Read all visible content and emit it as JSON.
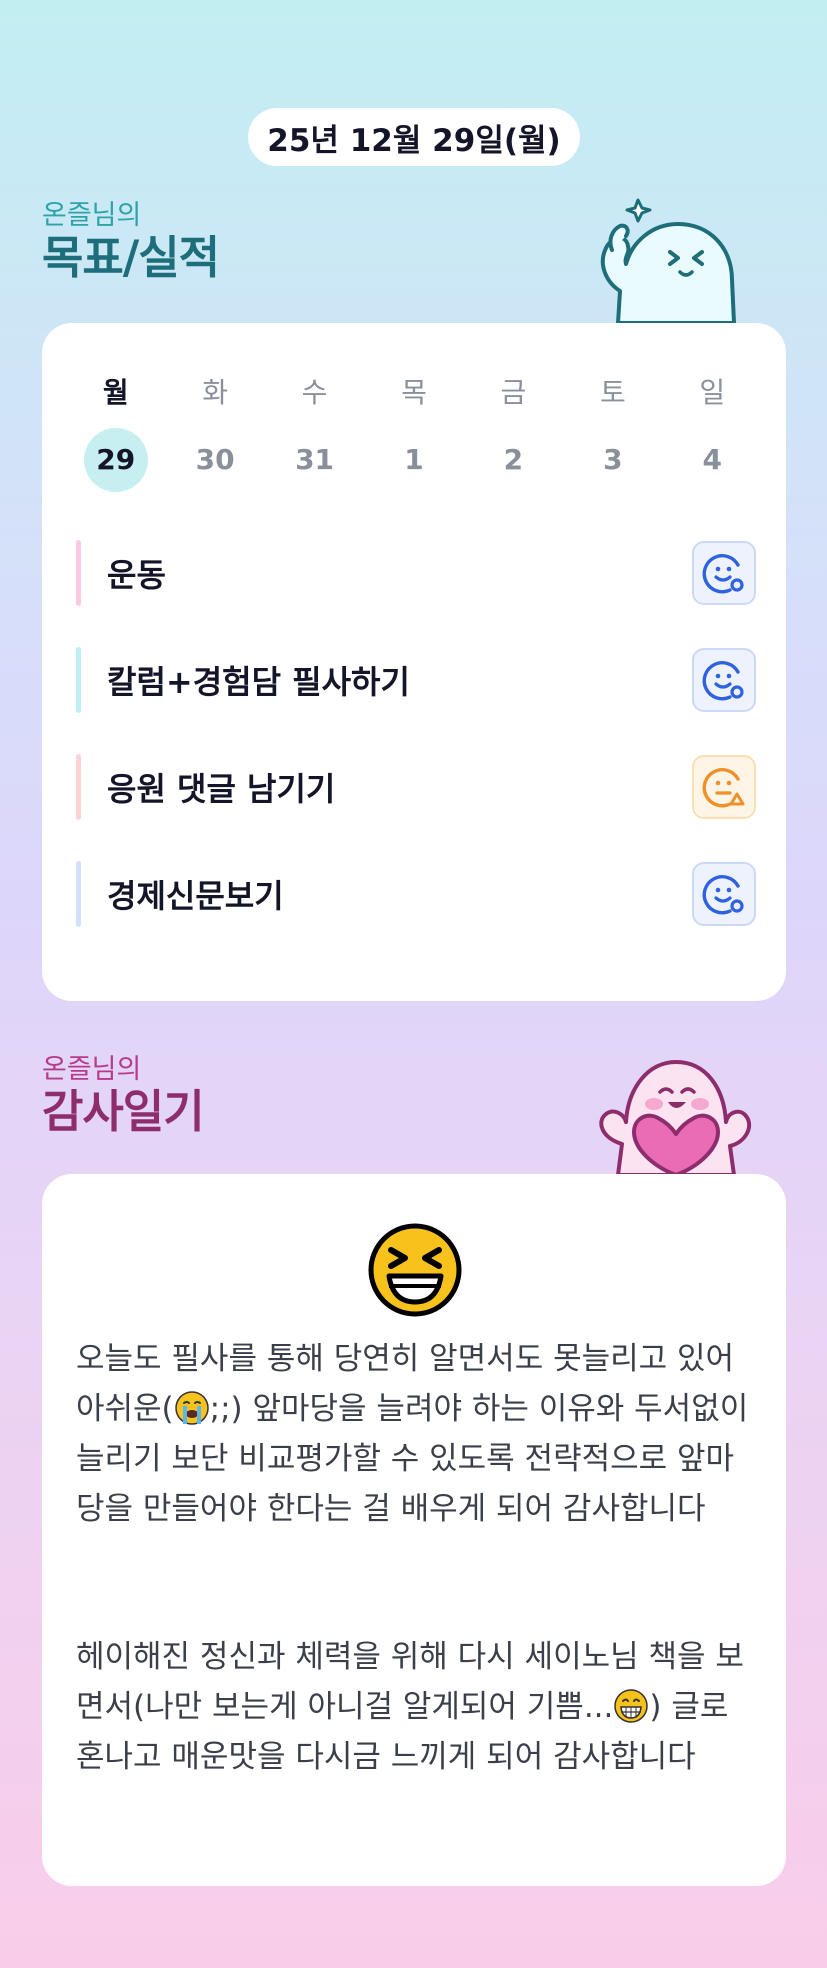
{
  "header": {
    "date": "25년 12월 29일(월)"
  },
  "goals_section": {
    "subtitle": "온즐님의",
    "title": "목표/실적",
    "week_days": [
      "월",
      "화",
      "수",
      "목",
      "금",
      "토",
      "일"
    ],
    "week_dates": [
      "29",
      "30",
      "31",
      "1",
      "2",
      "3",
      "4"
    ],
    "selected_index": 0,
    "items": [
      {
        "label": "운동",
        "bar_color": "#fcc8e2",
        "status": "done",
        "icon": "smile-check-icon"
      },
      {
        "label": "칼럼+경험담 필사하기",
        "bar_color": "#bdeff3",
        "status": "done",
        "icon": "smile-check-icon"
      },
      {
        "label": "응원 댓글 남기기",
        "bar_color": "#fcd3d3",
        "status": "partial",
        "icon": "meh-triangle-icon"
      },
      {
        "label": "경제신문보기",
        "bar_color": "#d3dffb",
        "status": "done",
        "icon": "smile-check-icon"
      }
    ],
    "colors": {
      "done": "#2f62e0",
      "partial": "#f0902a"
    }
  },
  "diary_section": {
    "subtitle": "온즐님의",
    "title": "감사일기",
    "mood_icon": "laughing-squint-emoji",
    "paragraph1_a": "오늘도 필사를 통해 당연히 알면서도 못늘리고 있어 아쉬운(",
    "paragraph1_emoji": "crying-emoji",
    "paragraph1_b": ";;) 앞마당을 늘려야 하는 이유와 두서없이 늘리기 보단 비교평가할 수 있도록 전략적으로 앞마당을 만들어야 한다는 걸 배우게 되어 감사합니다",
    "paragraph2_a": "헤이해진 정신과 체력을 위해 다시 세이노님 책을 보면서(나만 보는게 아니걸 알게되어 기쁨...",
    "paragraph2_emoji": "grinning-emoji",
    "paragraph2_b": ") 글로 혼나고 매운맛을 다시금 느끼게 되어 감사합니다"
  }
}
